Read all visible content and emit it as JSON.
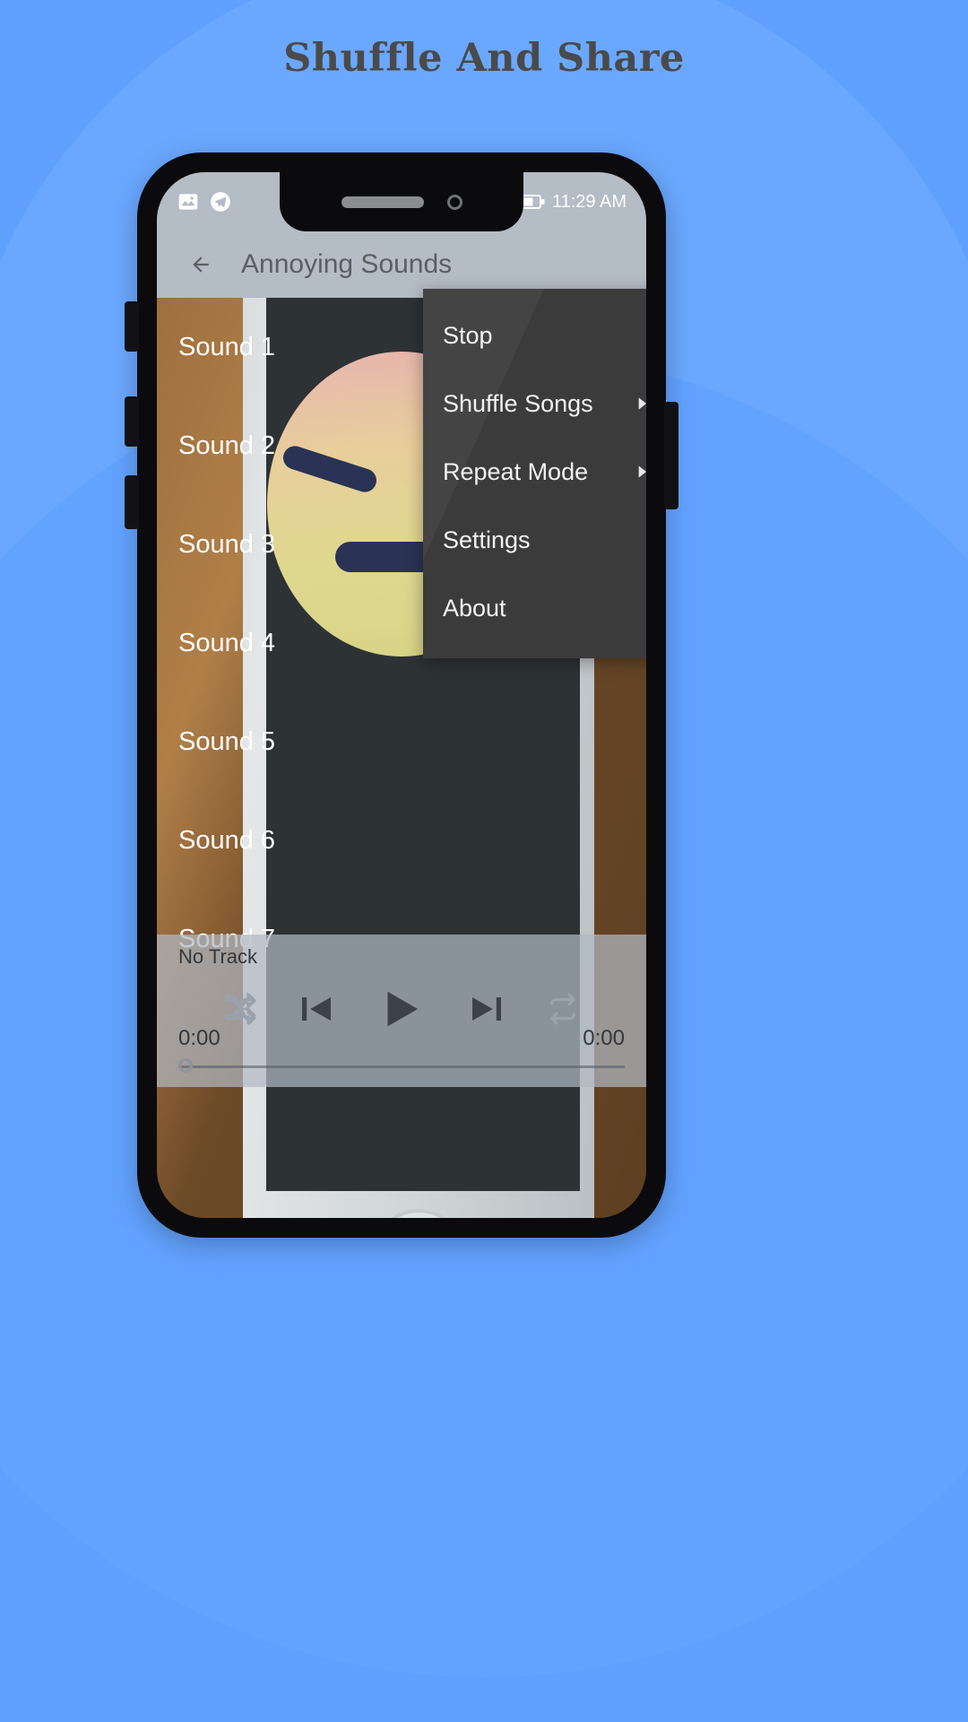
{
  "headline": "Shuffle And Share",
  "statusbar": {
    "icons": [
      "gallery-icon",
      "telegram-icon"
    ],
    "battery_percent_symbol": "%",
    "time": "11:29 AM"
  },
  "appbar": {
    "back_icon": "arrow-left-icon",
    "title": "Annoying Sounds"
  },
  "list": {
    "items": [
      {
        "label": "Sound 1"
      },
      {
        "label": "Sound 2"
      },
      {
        "label": "Sound 3"
      },
      {
        "label": "Sound 4"
      },
      {
        "label": "Sound 5"
      },
      {
        "label": "Sound 6"
      },
      {
        "label": "Sound 7"
      }
    ]
  },
  "player": {
    "track_title": "No Track",
    "elapsed": "0:00",
    "duration": "0:00",
    "controls": [
      {
        "name": "shuffle-icon",
        "label": "Shuffle"
      },
      {
        "name": "previous-icon",
        "label": "Previous"
      },
      {
        "name": "play-icon",
        "label": "Play"
      },
      {
        "name": "next-icon",
        "label": "Next"
      },
      {
        "name": "repeat-icon",
        "label": "Repeat"
      }
    ],
    "progress_percent": 0
  },
  "menu": {
    "items": [
      {
        "label": "Stop",
        "submenu": false
      },
      {
        "label": "Shuffle Songs",
        "submenu": true
      },
      {
        "label": "Repeat Mode",
        "submenu": true
      },
      {
        "label": "Settings",
        "submenu": false
      },
      {
        "label": "About",
        "submenu": false
      }
    ]
  },
  "colors": {
    "background": "#5fa0ff",
    "headline": "#4a4a4a",
    "appbar": "#b4bcc6",
    "menu_bg": "#444444",
    "menu_text": "#f2f2f2",
    "list_text": "#ffffff"
  }
}
